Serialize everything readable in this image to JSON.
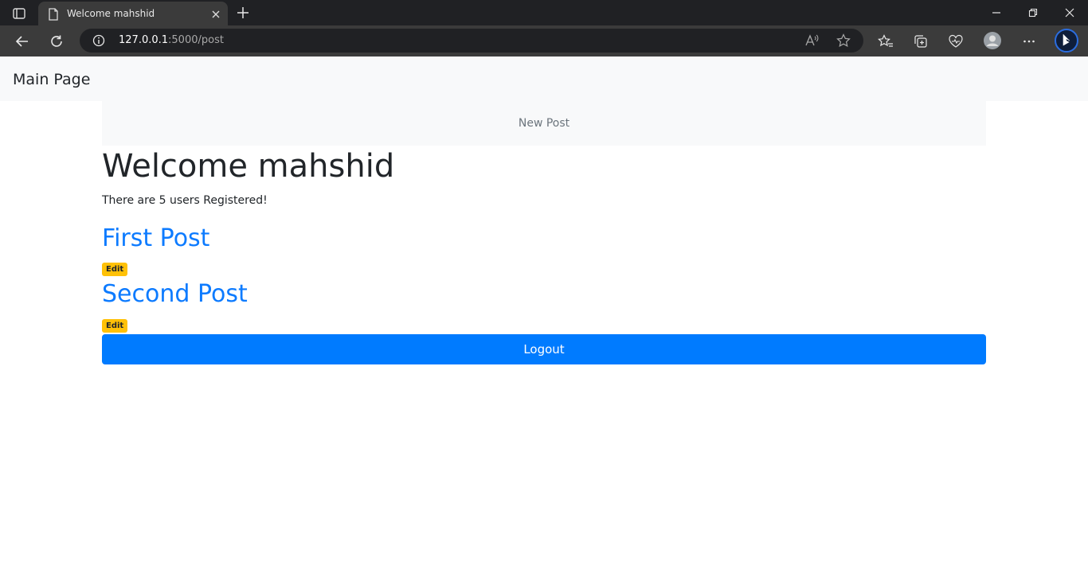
{
  "browser": {
    "tab_title": "Welcome mahshid",
    "url_host": "127.0.0.1",
    "url_path": ":5000/post"
  },
  "navbar": {
    "brand": "Main Page",
    "new_post_link": "New Post"
  },
  "main": {
    "heading": "Welcome mahshid",
    "users_text": "There are 5 users Registered!",
    "posts": [
      {
        "title": "First Post",
        "edit_label": "Edit"
      },
      {
        "title": "Second Post",
        "edit_label": "Edit"
      }
    ],
    "logout_label": "Logout"
  },
  "colors": {
    "link": "#0d7bff",
    "badge": "#ffc107",
    "primary_button": "#007bff",
    "navbar_bg": "#f8f9fa"
  }
}
